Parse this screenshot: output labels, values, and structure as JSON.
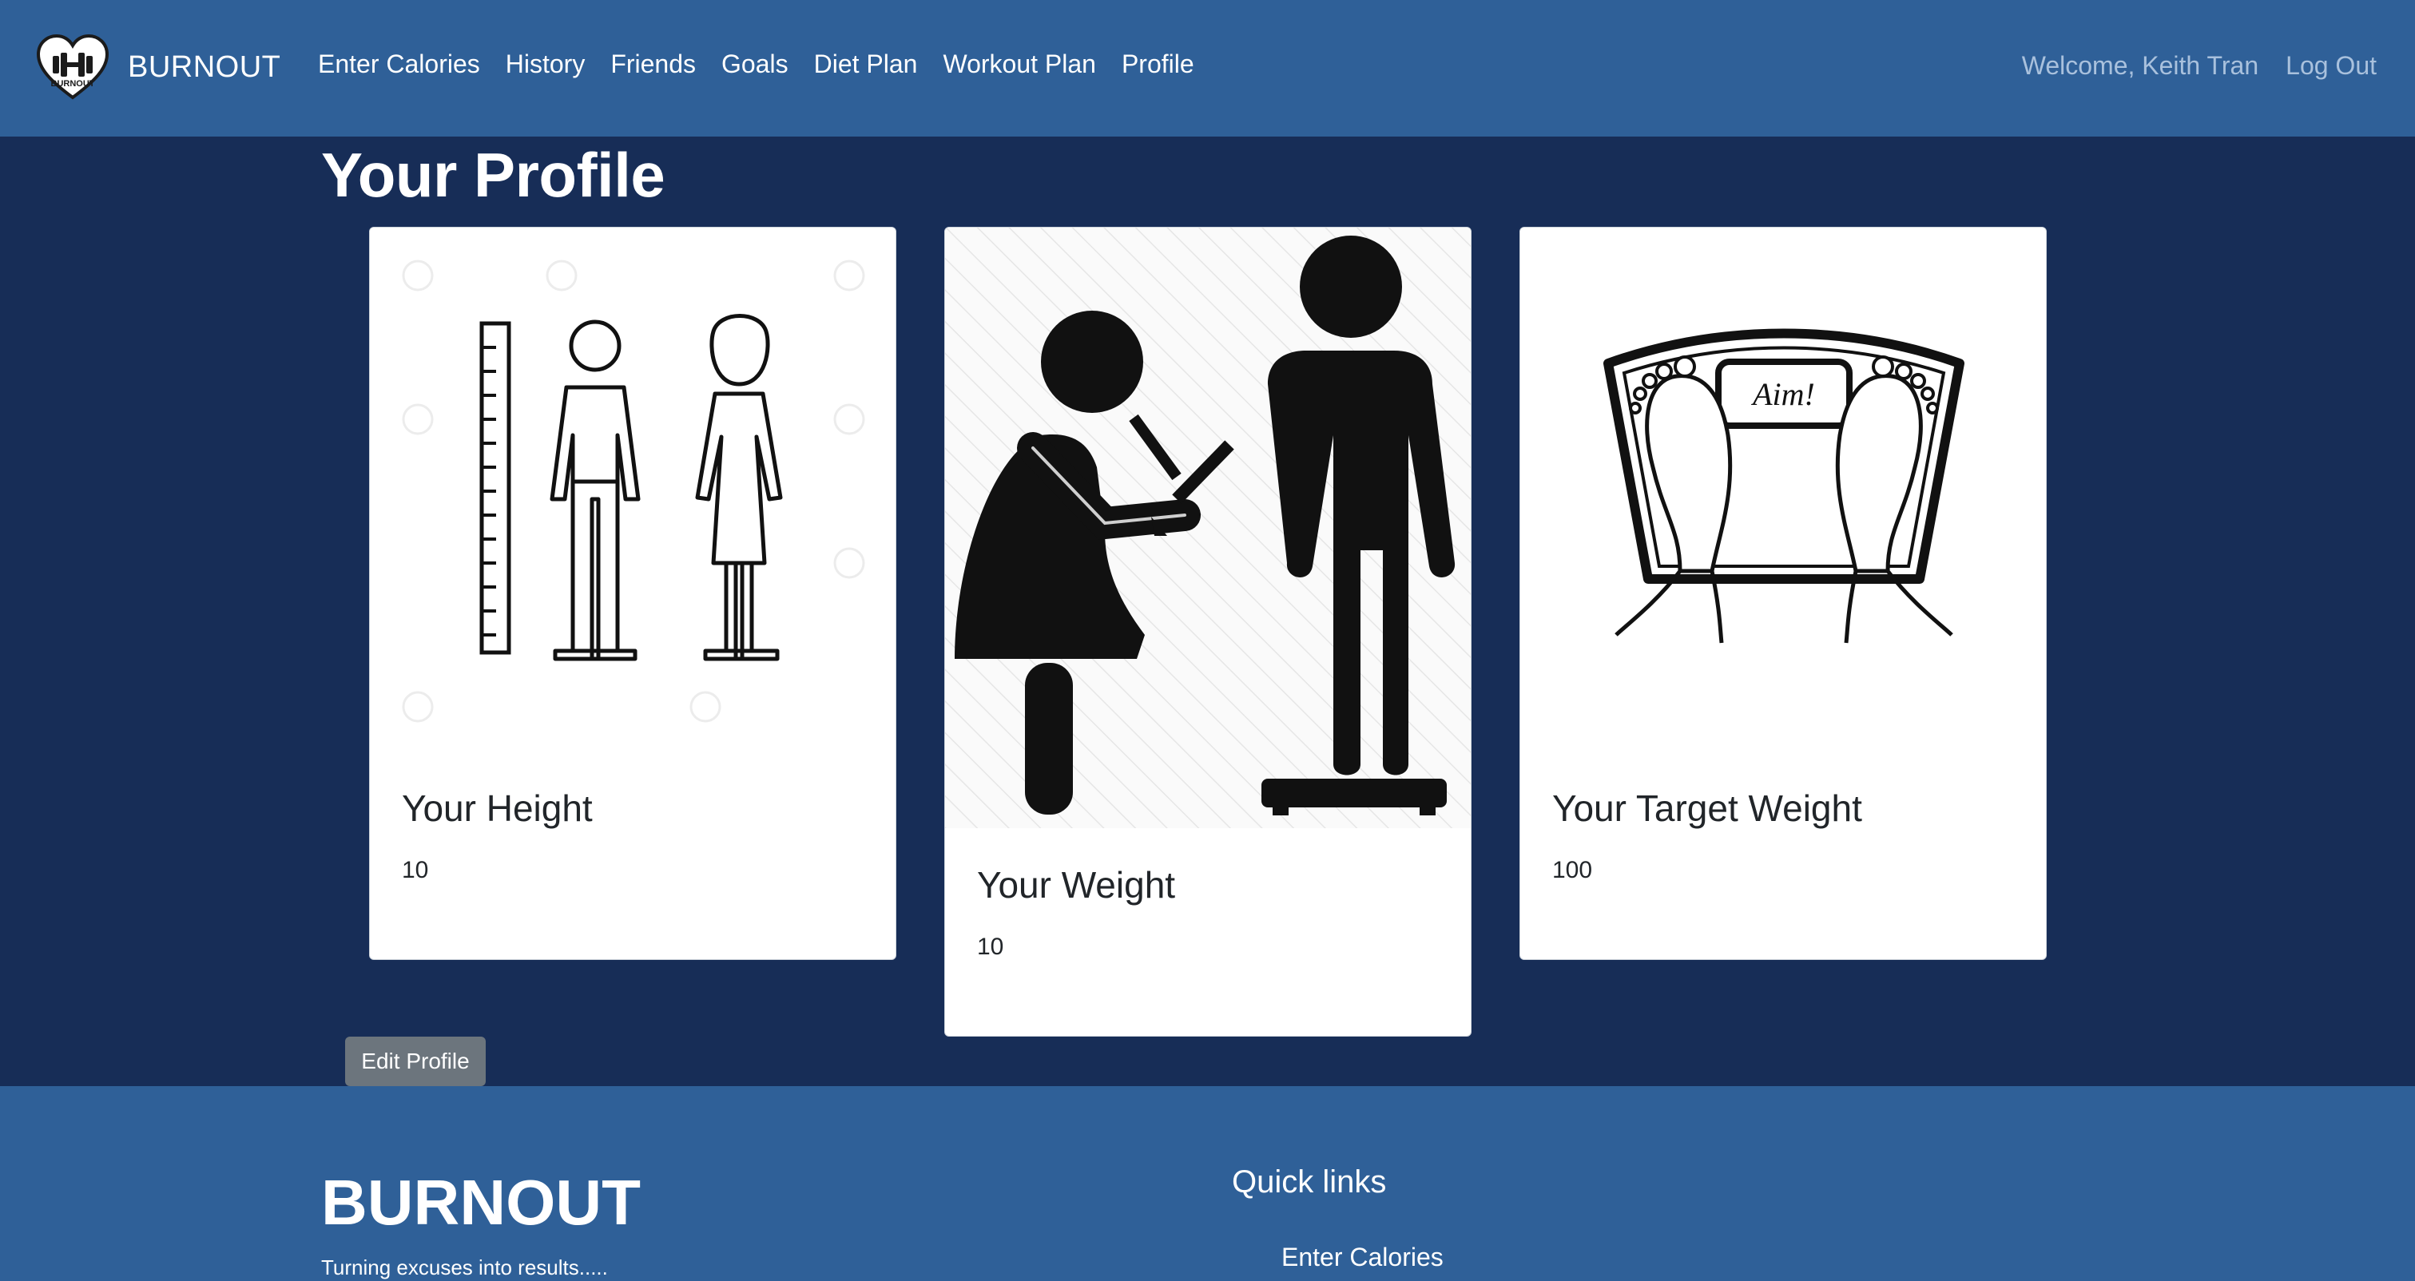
{
  "navbar": {
    "brand": "BURNOUT",
    "logo_text": "BURNOUT",
    "links": [
      "Enter Calories",
      "History",
      "Friends",
      "Goals",
      "Diet Plan",
      "Workout Plan",
      "Profile"
    ],
    "welcome": "Welcome, Keith Tran",
    "logout": "Log Out"
  },
  "main": {
    "title": "Your Profile",
    "cards": {
      "height": {
        "title": "Your Height",
        "value": "10",
        "icon": "height-measure-icon"
      },
      "weight": {
        "title": "Your Weight",
        "value": "10",
        "icon": "weigh-in-icon"
      },
      "target": {
        "title": "Your Target Weight",
        "value": "100",
        "icon": "scale-aim-icon",
        "scale_text": "Aim!"
      }
    },
    "edit_button": "Edit Profile"
  },
  "footer": {
    "brand": "BURNOUT",
    "tagline": "Turning excuses into results.....",
    "quick_links_heading": "Quick links",
    "links": [
      "Enter Calories"
    ]
  },
  "colors": {
    "navbar_bg": "#2f6098",
    "page_bg": "#172d57",
    "button_secondary": "#6c757d"
  }
}
